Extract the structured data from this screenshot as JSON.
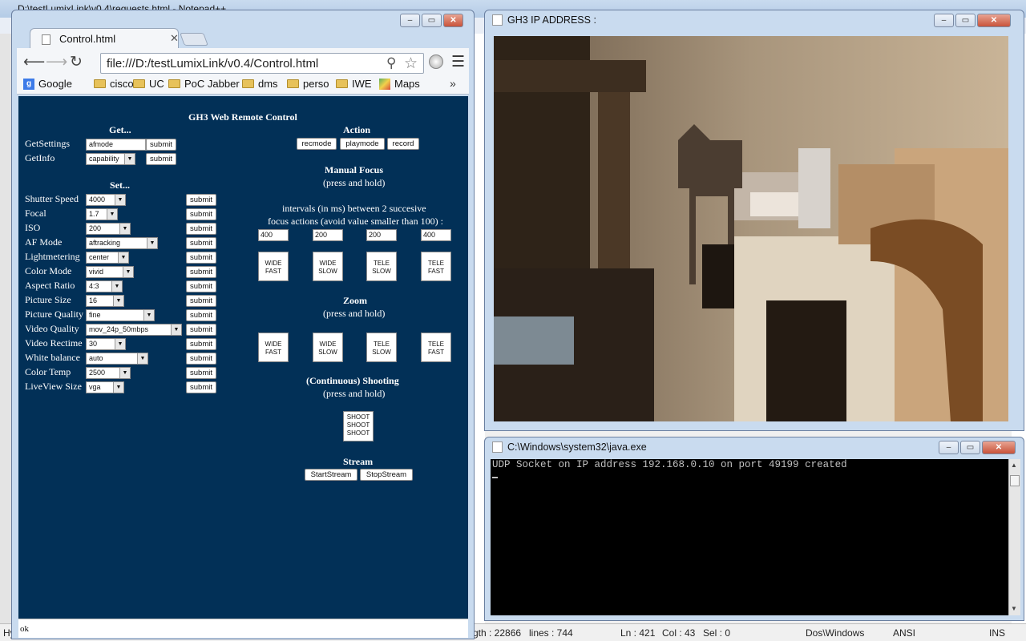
{
  "notepad": {
    "title": "D:\\testLumixLink\\v0.4\\requests.html - Notepad++",
    "status": {
      "left": "Hy",
      "length": "gth : 22866",
      "lines": "lines : 744",
      "ln": "Ln : 421",
      "col": "Col : 43",
      "sel": "Sel : 0",
      "eol": "Dos\\Windows",
      "encoding": "ANSI",
      "mode": "INS"
    }
  },
  "chrome": {
    "tab_title": "Control.html",
    "url": "file:///D:/testLumixLink/v0.4/Control.html",
    "bookmarks": [
      "Google",
      "cisco",
      "UC",
      "PoC Jabber",
      "dms",
      "perso",
      "IWE",
      "Maps"
    ],
    "bookmarks_more": "»",
    "status_text": "ok"
  },
  "page": {
    "title": "GH3 Web Remote Control",
    "get_heading": "Get...",
    "get_rows": [
      {
        "label": "GetSettings",
        "value": "afmode",
        "button": "submit"
      },
      {
        "label": "GetInfo",
        "value": "capability",
        "button": "submit"
      }
    ],
    "set_heading": "Set...",
    "set_rows": [
      {
        "label": "Shutter Speed",
        "value": "4000",
        "button": "submit"
      },
      {
        "label": "Focal",
        "value": "1.7",
        "button": "submit"
      },
      {
        "label": "ISO",
        "value": "200",
        "button": "submit"
      },
      {
        "label": "AF Mode",
        "value": "aftracking",
        "button": "submit"
      },
      {
        "label": "Lightmetering",
        "value": "center",
        "button": "submit"
      },
      {
        "label": "Color Mode",
        "value": "vivid",
        "button": "submit"
      },
      {
        "label": "Aspect Ratio",
        "value": "4:3",
        "button": "submit"
      },
      {
        "label": "Picture Size",
        "value": "16",
        "button": "submit"
      },
      {
        "label": "Picture Quality",
        "value": "fine",
        "button": "submit"
      },
      {
        "label": "Video Quality",
        "value": "mov_24p_50mbps",
        "button": "submit"
      },
      {
        "label": "Video Rectime",
        "value": "30",
        "button": "submit"
      },
      {
        "label": "White balance",
        "value": "auto",
        "button": "submit"
      },
      {
        "label": "Color Temp",
        "value": "2500",
        "button": "submit"
      },
      {
        "label": "LiveView Size",
        "value": "vga",
        "button": "submit"
      }
    ],
    "action_heading": "Action",
    "action_buttons": [
      "recmode",
      "playmode",
      "record"
    ],
    "focus_heading": "Manual Focus",
    "press_hold": "(press and hold)",
    "intervals_line1": "intervals (in ms) between 2 succesive",
    "intervals_line2": "focus actions (avoid value smaller than 100) :",
    "intervals": [
      "400",
      "200",
      "200",
      "400"
    ],
    "focus_buttons": [
      "WIDE\nFAST",
      "WIDE\nSLOW",
      "TELE\nSLOW",
      "TELE\nFAST"
    ],
    "zoom_heading": "Zoom",
    "zoom_buttons": [
      "WIDE\nFAST",
      "WIDE\nSLOW",
      "TELE\nSLOW",
      "TELE\nFAST"
    ],
    "shooting_heading": "(Continuous) Shooting",
    "shoot_button": "SHOOT\nSHOOT\nSHOOT",
    "stream_heading": "Stream",
    "stream_buttons": [
      "StartStream",
      "StopStream"
    ]
  },
  "gh3_window": {
    "title": "GH3 IP ADDRESS :"
  },
  "java_window": {
    "title": "C:\\Windows\\system32\\java.exe",
    "console_line": "UDP Socket on IP address 192.168.0.10 on port 49199 created"
  },
  "colors": {
    "page_background": "#023057",
    "console_background": "#000000"
  }
}
